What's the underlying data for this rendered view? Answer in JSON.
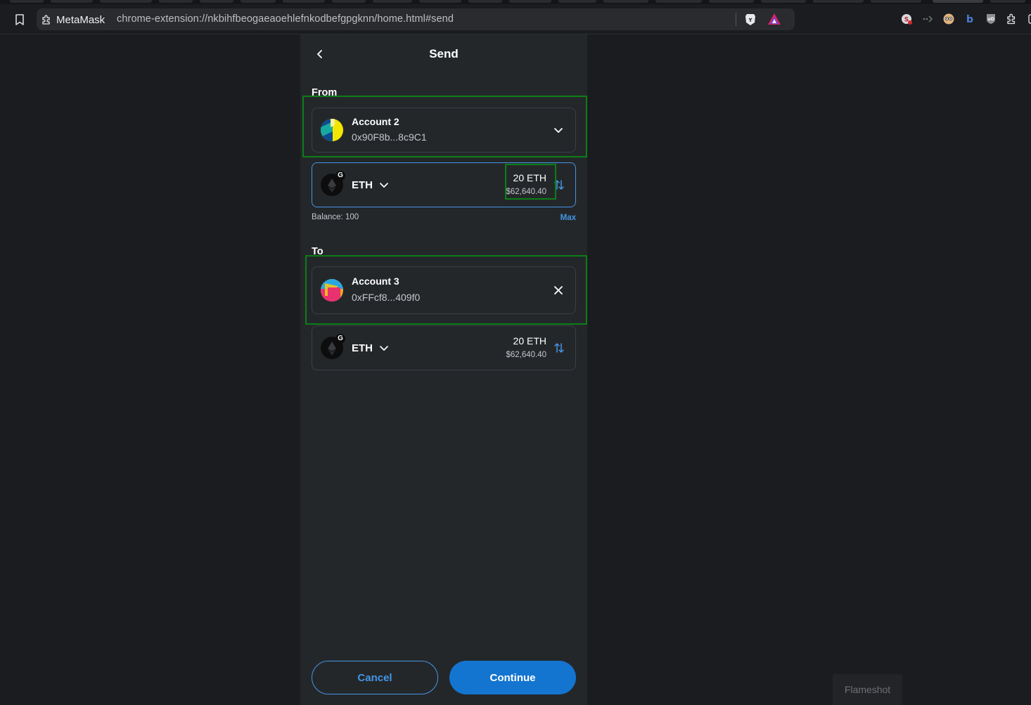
{
  "browser": {
    "site_name": "MetaMask",
    "url": "chrome-extension://nkbihfbeogaeaoehlefnkodbefgpgknn/home.html#send",
    "extension_icons": [
      "noscript-icon",
      "dots-arrow-icon",
      "face-icon",
      "b-icon",
      "ublock-icon",
      "puzzle-icon"
    ]
  },
  "header": {
    "title": "Send"
  },
  "from": {
    "label": "From",
    "account_name": "Account 2",
    "account_address": "0x90F8b...8c9C1",
    "asset": {
      "symbol": "ETH",
      "badge": "G",
      "amount": "20 ETH",
      "fiat": "$62,640.40"
    },
    "balance": "Balance: 100",
    "max_label": "Max"
  },
  "to": {
    "label": "To",
    "account_name": "Account 3",
    "account_address": "0xFFcf8...409f0",
    "asset": {
      "symbol": "ETH",
      "badge": "G",
      "amount": "20 ETH",
      "fiat": "$62,640.40"
    }
  },
  "footer": {
    "cancel_label": "Cancel",
    "continue_label": "Continue"
  },
  "overlay": {
    "flameshot_label": "Flameshot"
  },
  "colors": {
    "accent": "#4495e6",
    "primary_button": "#1475d0",
    "annotation": "#0c7e17",
    "panel_bg": "#24272a"
  }
}
